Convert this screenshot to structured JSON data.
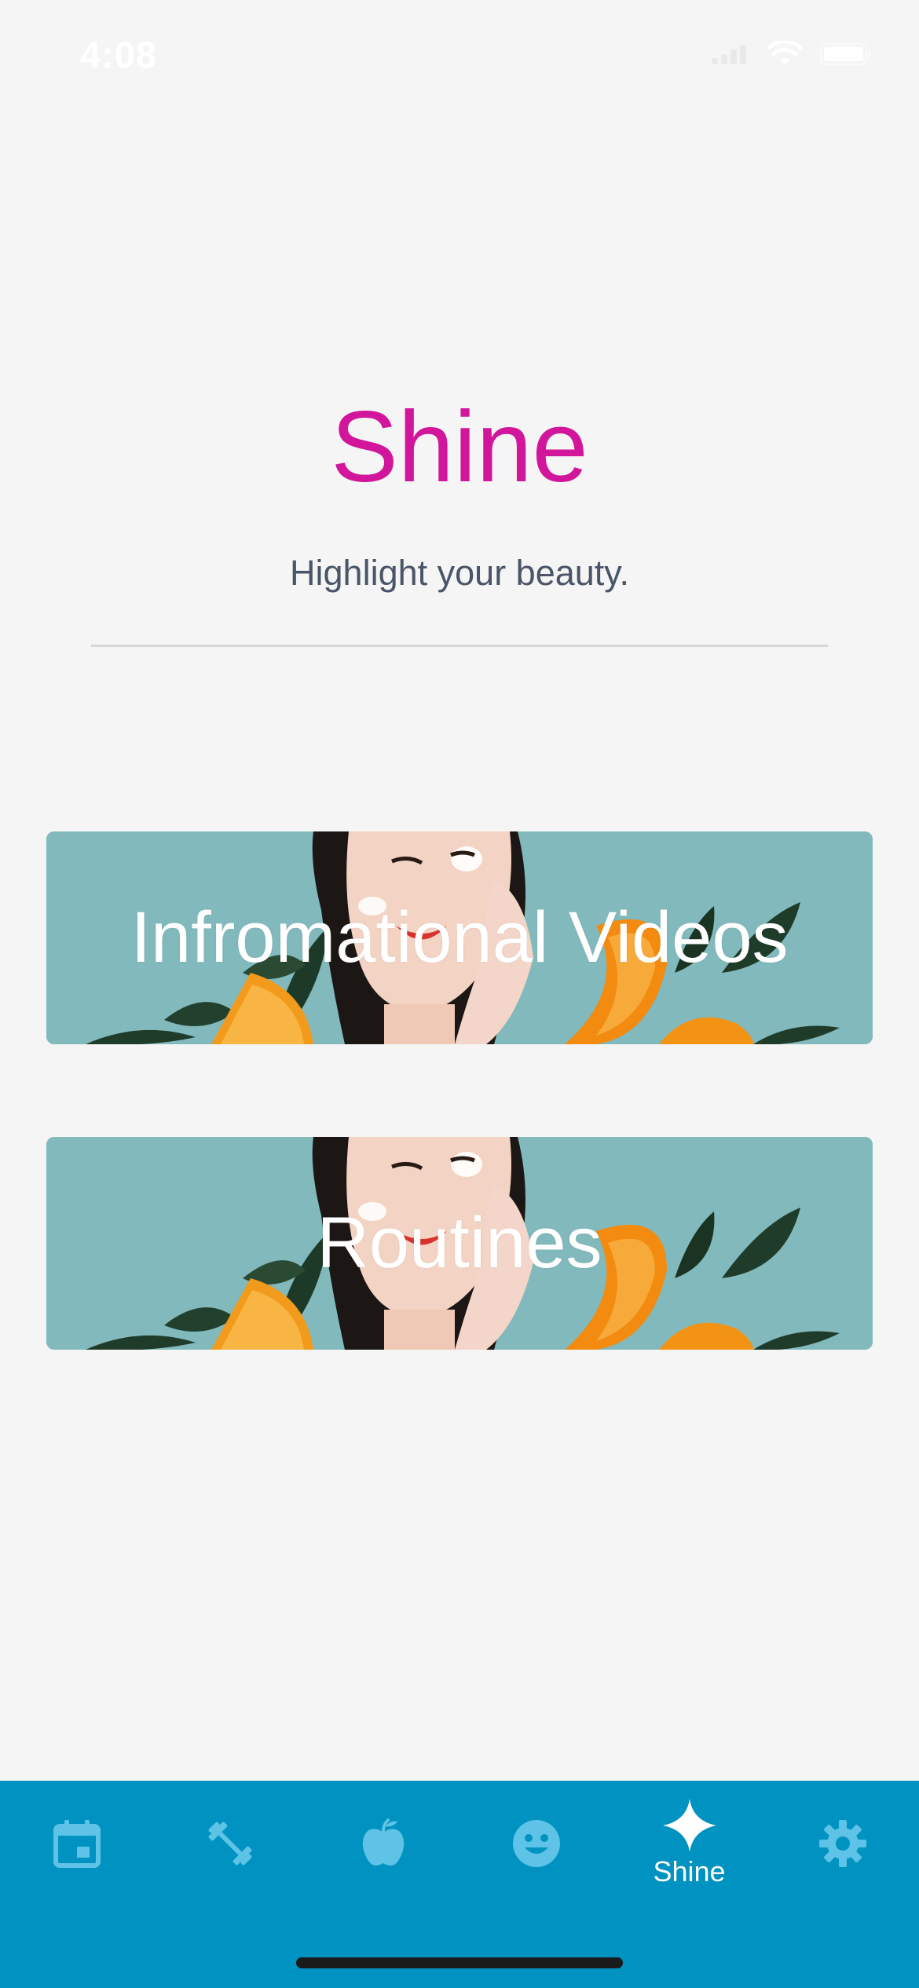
{
  "status_bar": {
    "time": "4:08"
  },
  "header": {
    "title": "Shine",
    "subtitle": "Highlight your beauty."
  },
  "cards": [
    {
      "label": "Infromational Videos"
    },
    {
      "label": "Routines"
    }
  ],
  "tab_bar": {
    "active_index": 4,
    "tabs": [
      {
        "icon": "calendar-icon",
        "label": ""
      },
      {
        "icon": "dumbbell-icon",
        "label": ""
      },
      {
        "icon": "apple-icon",
        "label": ""
      },
      {
        "icon": "smiley-face-icon",
        "label": ""
      },
      {
        "icon": "sparkle-icon",
        "label": "Shine"
      },
      {
        "icon": "gear-icon",
        "label": ""
      }
    ]
  },
  "colors": {
    "accent": "#d1169b",
    "tab_bar": "#0093c1",
    "tab_icon_inactive": "#5ec3e6",
    "card_background": "#82b9bc"
  }
}
